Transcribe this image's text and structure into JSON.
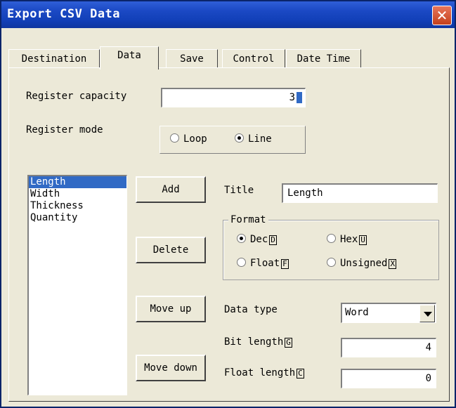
{
  "window": {
    "title": "Export CSV Data",
    "close_symbol": "✕"
  },
  "tabs": [
    "Destination",
    "Data",
    "Save",
    "Control",
    "Date Time"
  ],
  "register": {
    "capacity_label": "Register capacity",
    "capacity_value": "3",
    "mode_label": "Register mode",
    "mode_options": [
      "Loop",
      "Line"
    ],
    "mode_selected": "Line"
  },
  "list": {
    "items": [
      "Length",
      "Width",
      "Thickness",
      "Quantity"
    ],
    "selected": "Length"
  },
  "buttons": {
    "add": "Add",
    "delete": "Delete",
    "move_up": "Move up",
    "move_down": "Move down"
  },
  "title_field": {
    "label": "Title",
    "value": "Length"
  },
  "format": {
    "label": "Format",
    "dec": "Dec",
    "dec_key": "D",
    "hex": "Hex",
    "hex_key": "U",
    "float": "Float",
    "float_key": "F",
    "unsigned": "Unsigned",
    "unsigned_key": "X",
    "selected": "Dec"
  },
  "data_type": {
    "label": "Data type",
    "value": "Word"
  },
  "bit_length": {
    "label": "Bit length",
    "key": "G",
    "value": "4"
  },
  "float_length": {
    "label": "Float length",
    "key": "C",
    "value": "0"
  },
  "colors": {
    "titlebar": "#1240b8",
    "face": "#ece9d8",
    "selection": "#316ac5",
    "close": "#c4401c"
  }
}
